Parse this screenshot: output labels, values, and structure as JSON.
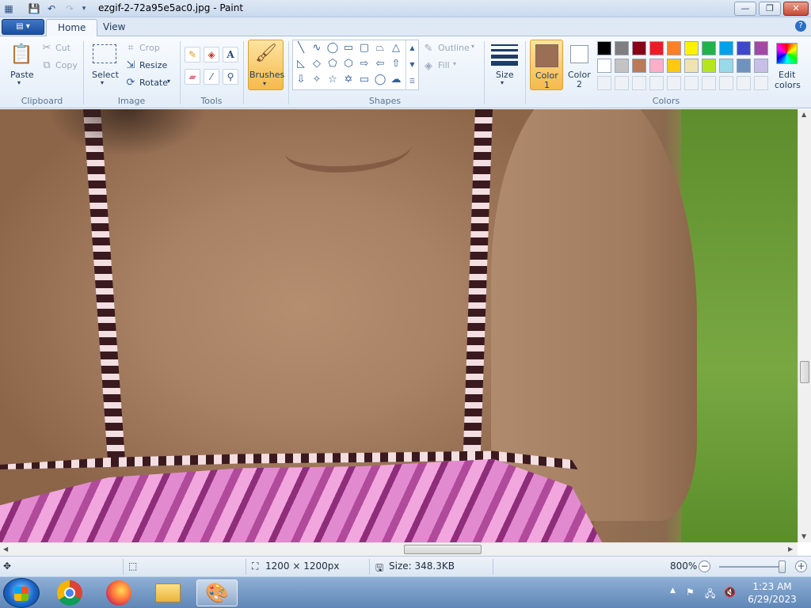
{
  "window": {
    "title": "ezgif-2-72a95e5ac0.jpg - Paint",
    "minimize": "—",
    "maximize": "❐",
    "close": "✕"
  },
  "quick_access": [
    "save-icon",
    "undo-icon",
    "redo-icon",
    "customize-dropdown-icon"
  ],
  "tabs": {
    "home": "Home",
    "view": "View"
  },
  "ribbon": {
    "clipboard": {
      "paste": "Paste",
      "cut": "Cut",
      "copy": "Copy",
      "group": "Clipboard"
    },
    "image": {
      "select": "Select",
      "crop": "Crop",
      "resize": "Resize",
      "rotate": "Rotate",
      "group": "Image"
    },
    "tools": {
      "group": "Tools",
      "text_glyph": "A"
    },
    "brushes": "Brushes",
    "shapes": {
      "outline": "Outline",
      "fill": "Fill",
      "group": "Shapes"
    },
    "size": "Size",
    "color1": {
      "label": "Color",
      "num": "1",
      "value": "#9a6f55"
    },
    "color2": {
      "label": "Color",
      "num": "2",
      "value": "#ffffff"
    },
    "colors_group": "Colors",
    "edit_colors": {
      "line1": "Edit",
      "line2": "colors"
    },
    "palette_row1": [
      "#000000",
      "#7f7f7f",
      "#880015",
      "#ed1c24",
      "#ff7f27",
      "#fff200",
      "#22b14c",
      "#00a2e8",
      "#3f48cc",
      "#a349a4"
    ],
    "palette_row2": [
      "#ffffff",
      "#c3c3c3",
      "#b97a57",
      "#ffaec9",
      "#ffc90e",
      "#efe4b0",
      "#b5e61d",
      "#99d9ea",
      "#7092be",
      "#c8bfe7"
    ]
  },
  "status": {
    "dimensions": "1200 × 1200px",
    "size": "Size: 348.3KB",
    "zoom": "800%",
    "zoom_minus": "−",
    "zoom_plus": "+"
  },
  "taskbar": {
    "apps": [
      "chrome-icon",
      "firefox-icon",
      "file-explorer-icon",
      "paint-icon"
    ],
    "time": "1:23 AM",
    "date": "6/29/2023"
  }
}
